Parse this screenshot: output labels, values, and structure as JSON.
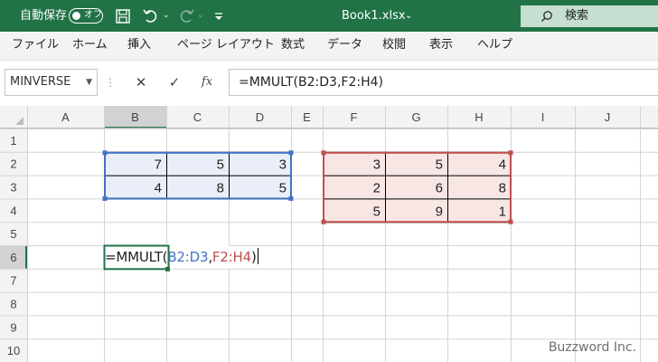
{
  "titlebar": {
    "autosave_label": "自動保存",
    "autosave_state": "オフ",
    "filename": "Book1.xlsx",
    "filename_chevron": "⌄",
    "search_label": "検索"
  },
  "ribbon": {
    "tabs": [
      "ファイル",
      "ホーム",
      "挿入",
      "ページ レイアウト",
      "数式",
      "データ",
      "校閲",
      "表示",
      "ヘルプ"
    ]
  },
  "formula_bar": {
    "name_box": "MINVERSE",
    "cancel_symbol": "✕",
    "confirm_symbol": "✓",
    "fx_symbol": "fx",
    "formula": "=MMULT(B2:D3,F2:H4)"
  },
  "grid": {
    "columns": [
      "A",
      "B",
      "C",
      "D",
      "E",
      "F",
      "G",
      "H",
      "I",
      "J"
    ],
    "rows": [
      "1",
      "2",
      "3",
      "4",
      "5",
      "6",
      "7",
      "8",
      "9",
      "10"
    ],
    "active_column": "B",
    "active_row": "6",
    "matrix_a": [
      [
        "7",
        "5",
        "3"
      ],
      [
        "4",
        "8",
        "5"
      ]
    ],
    "matrix_b": [
      [
        "3",
        "5",
        "4"
      ],
      [
        "2",
        "6",
        "8"
      ],
      [
        "5",
        "9",
        "1"
      ]
    ],
    "matrix_a_color": "#4472c4",
    "matrix_b_color": "#c0504d",
    "editing_cell": {
      "prefix": "=MMULT(",
      "ref1": "B2:D3",
      "sep": ",",
      "ref2": "F2:H4",
      "suffix": ")"
    }
  },
  "watermark": "Buzzword Inc."
}
